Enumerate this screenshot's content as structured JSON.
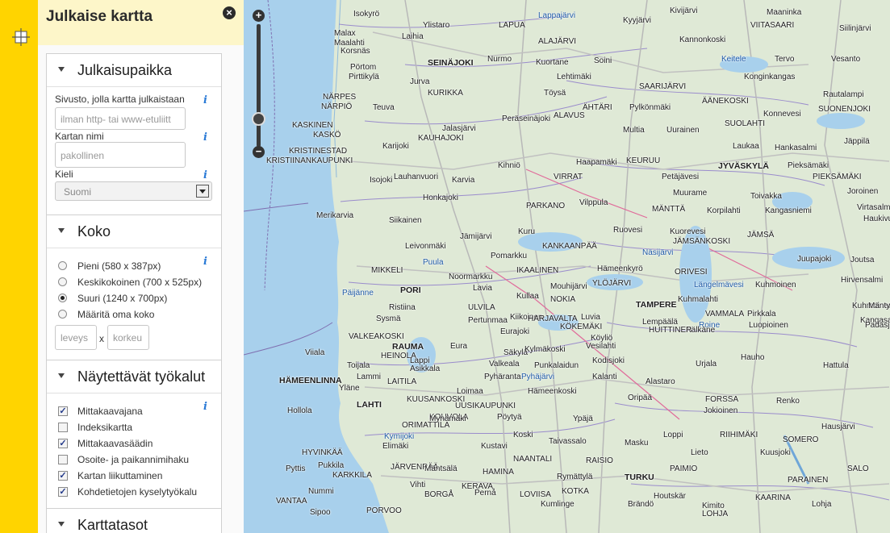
{
  "sidebar": {
    "tool_icon": "crosshair-icon"
  },
  "panel": {
    "title": "Julkaise kartta",
    "close_icon": "close-icon",
    "sections": {
      "location": {
        "title": "Julkaisupaikka",
        "site_label": "Sivusto, jolla kartta julkaistaan",
        "site_placeholder": "ilman http- tai www-etuliitt",
        "name_label": "Kartan nimi",
        "name_placeholder": "pakollinen",
        "language_label": "Kieli",
        "language_value": "Suomi"
      },
      "size": {
        "title": "Koko",
        "options": [
          "Pieni (580 x 387px)",
          "Keskikokoinen (700 x 525px)",
          "Suuri (1240 x 700px)",
          "Määritä oma koko"
        ],
        "selected": "Suuri (1240 x 700px)",
        "width_placeholder": "leveys",
        "separator": "x",
        "height_placeholder": "korkeu"
      },
      "tools": {
        "title": "Näytettävät työkalut",
        "items": [
          {
            "label": "Mittakaavajana",
            "checked": true
          },
          {
            "label": "Indeksikartta",
            "checked": false
          },
          {
            "label": "Mittakaavasäädin",
            "checked": true
          },
          {
            "label": "Osoite- ja paikannimihaku",
            "checked": false
          },
          {
            "label": "Kartan liikuttaminen",
            "checked": true
          },
          {
            "label": "Kohdetietojen kyselytyökalu",
            "checked": true
          }
        ]
      },
      "layers": {
        "title": "Karttatasot"
      }
    },
    "info_glyph": "i",
    "check_glyph": "✓"
  },
  "map": {
    "zoom_in": "+",
    "zoom_out": "−",
    "labels": [
      {
        "t": "Isokyrö"
      },
      {
        "t": "Ylistaro"
      },
      {
        "t": "LAPUA"
      },
      {
        "t": "Lappajärvi",
        "w": 1
      },
      {
        "t": "Kyyjärvi"
      },
      {
        "t": "Kivijärvi"
      },
      {
        "t": "Maaninka"
      },
      {
        "t": "Siilinjärvi"
      },
      {
        "t": "Malax"
      },
      {
        "t": "Maalahti"
      },
      {
        "t": "Laihia"
      },
      {
        "t": "ALAJÄRVI"
      },
      {
        "t": "Kannonkoski"
      },
      {
        "t": "VIITASAARI"
      },
      {
        "t": "Korsnäs"
      },
      {
        "t": "SEINÄJOKI",
        "b": 1
      },
      {
        "t": "Nurmo"
      },
      {
        "t": "Kuortane"
      },
      {
        "t": "Soini"
      },
      {
        "t": "Keitele",
        "w": 1
      },
      {
        "t": "Tervo"
      },
      {
        "t": "Vesanto"
      },
      {
        "t": "Pörtom"
      },
      {
        "t": "Pirttikylä"
      },
      {
        "t": "Lehtimäki"
      },
      {
        "t": "Konginkangas"
      },
      {
        "t": "Jurva"
      },
      {
        "t": "KURIKKA"
      },
      {
        "t": "Töysä"
      },
      {
        "t": "SAARIJÄRVI"
      },
      {
        "t": "Rautalampi"
      },
      {
        "t": "NÄRPES"
      },
      {
        "t": "NÄRPIÖ"
      },
      {
        "t": "Teuva"
      },
      {
        "t": "ÄHTÄRI"
      },
      {
        "t": "Pylkönmäki"
      },
      {
        "t": "ÄÄNEKOSKI"
      },
      {
        "t": "SUONENJOKI"
      },
      {
        "t": "Peräseinäjoki"
      },
      {
        "t": "ALAVUS"
      },
      {
        "t": "Konnevesi"
      },
      {
        "t": "SUOLAHTI"
      },
      {
        "t": "KASKINEN"
      },
      {
        "t": "KASKÖ"
      },
      {
        "t": "Jalasjärvi"
      },
      {
        "t": "Multia"
      },
      {
        "t": "Uurainen"
      },
      {
        "t": "KAUHAJOKI"
      },
      {
        "t": "KRISTINESTAD"
      },
      {
        "t": "KRISTIINANKAUPUNKI"
      },
      {
        "t": "Karijoki"
      },
      {
        "t": "Laukaa"
      },
      {
        "t": "Hankasalmi"
      },
      {
        "t": "Jäppilä"
      },
      {
        "t": "Kihniö"
      },
      {
        "t": "Haapamäki"
      },
      {
        "t": "KEURUU"
      },
      {
        "t": "JYVÄSKYLÄ",
        "b": 1
      },
      {
        "t": "Pieksämäki"
      },
      {
        "t": "Lauhanvuori"
      },
      {
        "t": "Isojoki"
      },
      {
        "t": "Karvia"
      },
      {
        "t": "VIRRAT"
      },
      {
        "t": "Petäjävesi"
      },
      {
        "t": "PIEKSÄMÄKI"
      },
      {
        "t": "Honkajoki"
      },
      {
        "t": "Muurame"
      },
      {
        "t": "Toivakka"
      },
      {
        "t": "Joroinen"
      },
      {
        "t": "Merikarvia"
      },
      {
        "t": "PARKANO"
      },
      {
        "t": "Vilppula"
      },
      {
        "t": "MÄNTTÄ"
      },
      {
        "t": "Korpilahti"
      },
      {
        "t": "Kangasniemi"
      },
      {
        "t": "Virtasalmi"
      },
      {
        "t": "Haukivuori"
      },
      {
        "t": "Siikainen"
      },
      {
        "t": "Jämijärvi"
      },
      {
        "t": "Kuru"
      },
      {
        "t": "Ruovesi"
      },
      {
        "t": "Kuorevesi"
      },
      {
        "t": "JÄMSÄNKOSKI"
      },
      {
        "t": "JÄMSÄ"
      },
      {
        "t": "Leivonmäki"
      },
      {
        "t": "KANKAANPÄÄ"
      },
      {
        "t": "Näsijärvi",
        "w": 1
      },
      {
        "t": "Juupajoki"
      },
      {
        "t": "Joutsa"
      },
      {
        "t": "Puula",
        "w": 1
      },
      {
        "t": "Pomarkku"
      },
      {
        "t": "IKAALINEN"
      },
      {
        "t": "Hämeenkyrö"
      },
      {
        "t": "ORIVESI"
      },
      {
        "t": "Kuhmoinen"
      },
      {
        "t": "Hirvensalmi"
      },
      {
        "t": "MIKKELI"
      },
      {
        "t": "Noormarkku"
      },
      {
        "t": "Lavia"
      },
      {
        "t": "Mouhijärvi"
      },
      {
        "t": "YLÖJÄRVI"
      },
      {
        "t": "Längelmävesi",
        "w": 1
      },
      {
        "t": "Päijänne",
        "w": 1
      },
      {
        "t": "PORI",
        "b": 1
      },
      {
        "t": "Kullaa"
      },
      {
        "t": "NOKIA"
      },
      {
        "t": "TAMPERE",
        "b": 1
      },
      {
        "t": "Kuhmalahti"
      },
      {
        "t": "Kuhmoinen"
      },
      {
        "t": "Mäntyharju"
      },
      {
        "t": "Ristiina"
      },
      {
        "t": "ULVILA"
      },
      {
        "t": "Kiikoinen"
      },
      {
        "t": "Luvia"
      },
      {
        "t": "VAMMALA"
      },
      {
        "t": "Pirkkala"
      },
      {
        "t": "Kangasala"
      },
      {
        "t": "Sysmä"
      },
      {
        "t": "Pertunmaa"
      },
      {
        "t": "HARJAVALTA"
      },
      {
        "t": "Lempäälä"
      },
      {
        "t": "Roine",
        "w": 1
      },
      {
        "t": "Luopioinen"
      },
      {
        "t": "Padasjoki"
      },
      {
        "t": "Eurajoki"
      },
      {
        "t": "KÖKEMÄKI"
      },
      {
        "t": "HUITTINEN"
      },
      {
        "t": "Pälkäne"
      },
      {
        "t": "VALKEAKOSKI"
      },
      {
        "t": "RAUMA",
        "b": 1
      },
      {
        "t": "Eura"
      },
      {
        "t": "Köyliö"
      },
      {
        "t": "Vesilahti"
      },
      {
        "t": "Viiala"
      },
      {
        "t": "HEINOLA"
      },
      {
        "t": "Lappi"
      },
      {
        "t": "Säkylä"
      },
      {
        "t": "Kylmäkoski"
      },
      {
        "t": "Hauho"
      },
      {
        "t": "Toijala"
      },
      {
        "t": "Asikkala"
      },
      {
        "t": "Valkeala"
      },
      {
        "t": "Kodisjoki"
      },
      {
        "t": "Punkalaidun"
      },
      {
        "t": "Urjala"
      },
      {
        "t": "Hattula"
      },
      {
        "t": "Lammi"
      },
      {
        "t": "Pyhäranta"
      },
      {
        "t": "Pyhäjärvi",
        "w": 1
      },
      {
        "t": "Kalanti"
      },
      {
        "t": "Alastaro"
      },
      {
        "t": "HÄMEENLINNA",
        "b": 1
      },
      {
        "t": "LAITILA"
      },
      {
        "t": "Yläne"
      },
      {
        "t": "Loimaa"
      },
      {
        "t": "Hämeenkoski"
      },
      {
        "t": "LAHTI",
        "b": 1
      },
      {
        "t": "KUUSANKOSKI"
      },
      {
        "t": "UUSIKAUPUNKI"
      },
      {
        "t": "Oripää"
      },
      {
        "t": "FORSSA"
      },
      {
        "t": "Renko"
      },
      {
        "t": "Hollola"
      },
      {
        "t": "KOUVOLA"
      },
      {
        "t": "Pöytyä"
      },
      {
        "t": "Ypäjä"
      },
      {
        "t": "Jokioinen"
      },
      {
        "t": "Hausjärvi"
      },
      {
        "t": "ORIMATTILA"
      },
      {
        "t": "Mynämäki"
      },
      {
        "t": "Koski"
      },
      {
        "t": "Loppi"
      },
      {
        "t": "RIIHIMÄKI"
      },
      {
        "t": "Kymijoki",
        "w": 1
      },
      {
        "t": "Kustavi"
      },
      {
        "t": "Taivassalo"
      },
      {
        "t": "Masku"
      },
      {
        "t": "SOMERO"
      },
      {
        "t": "HYVINKÄÄ"
      },
      {
        "t": "Pukkila"
      },
      {
        "t": "Elimäki"
      },
      {
        "t": "NAANTALI"
      },
      {
        "t": "RAISIO"
      },
      {
        "t": "Lieto"
      },
      {
        "t": "Kuusjoki"
      },
      {
        "t": "KARKKILA"
      },
      {
        "t": "JÄRVENPÄÄ"
      },
      {
        "t": "Mäntsälä"
      },
      {
        "t": "HAMINA"
      },
      {
        "t": "Rymättylä"
      },
      {
        "t": "TURKU",
        "b": 1
      },
      {
        "t": "PAIMIO"
      },
      {
        "t": "SALO"
      },
      {
        "t": "Nummi"
      },
      {
        "t": "Vihti"
      },
      {
        "t": "KERAVA"
      },
      {
        "t": "Pernå"
      },
      {
        "t": "LOVIISA"
      },
      {
        "t": "KOTKA"
      },
      {
        "t": "Houtskär"
      },
      {
        "t": "PARAINEN"
      },
      {
        "t": "KAARINA"
      },
      {
        "t": "Lohja"
      },
      {
        "t": "Sipoo"
      },
      {
        "t": "PORVOO"
      },
      {
        "t": "BORGÅ"
      },
      {
        "t": "Kumlinge"
      },
      {
        "t": "Brändö"
      },
      {
        "t": "Kimito"
      },
      {
        "t": "LOHJA"
      },
      {
        "t": "VANTAA"
      },
      {
        "t": "Pyttis"
      }
    ]
  }
}
